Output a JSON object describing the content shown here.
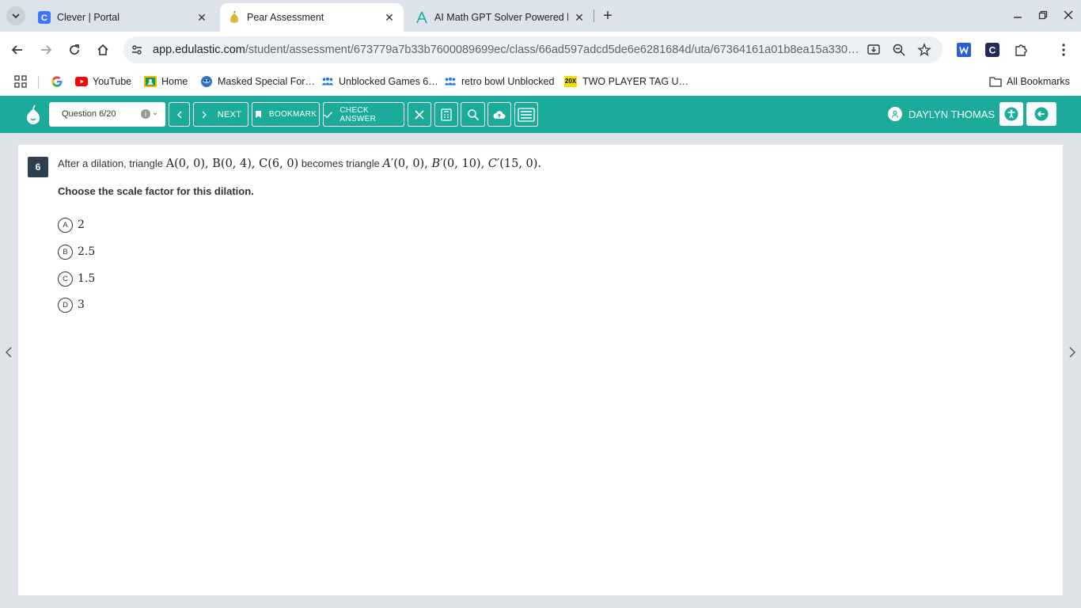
{
  "browser": {
    "tabs": [
      {
        "title": "Clever | Portal",
        "icon": "clever-icon"
      },
      {
        "title": "Pear Assessment",
        "icon": "pear-icon",
        "active": true
      },
      {
        "title": "AI Math GPT Solver Powered by",
        "icon": "mathgpt-icon"
      }
    ],
    "url_host": "app.edulastic.com",
    "url_path": "/student/assessment/673779a7b33b7600089699ec/class/66ad597adcd5de6e6281684d/uta/67364161a01b8ea15a330…",
    "bookmarks": [
      {
        "label": "YouTube",
        "icon": "youtube-icon"
      },
      {
        "label": "Home",
        "icon": "classroom-icon"
      },
      {
        "label": "Masked Special For…",
        "icon": "game-icon"
      },
      {
        "label": "Unblocked Games 6…",
        "icon": "people-icon"
      },
      {
        "label": "retro bowl Unblocked",
        "icon": "people-icon"
      },
      {
        "label": "TWO PLAYER TAG U…",
        "icon": "20x-icon"
      }
    ],
    "bookmark_20x_text": "20X",
    "all_bookmarks": "All Bookmarks"
  },
  "header": {
    "question_select": "Question 6/20",
    "next_label": "NEXT",
    "bookmark_label": "BOOKMARK",
    "check_answer_label": "CHECK ANSWER",
    "user_name": "DAYLYN THOMAS",
    "accent_color": "#1aab9b"
  },
  "question": {
    "number": "6",
    "stem_prefix": "After a dilation, triangle",
    "stem_middle": "becomes triangle",
    "instruction": "Choose the scale factor for this dilation.",
    "choices": [
      {
        "letter": "A",
        "value": "2"
      },
      {
        "letter": "B",
        "value": "2.5"
      },
      {
        "letter": "C",
        "value": "1.5"
      },
      {
        "letter": "D",
        "value": "3"
      }
    ]
  }
}
